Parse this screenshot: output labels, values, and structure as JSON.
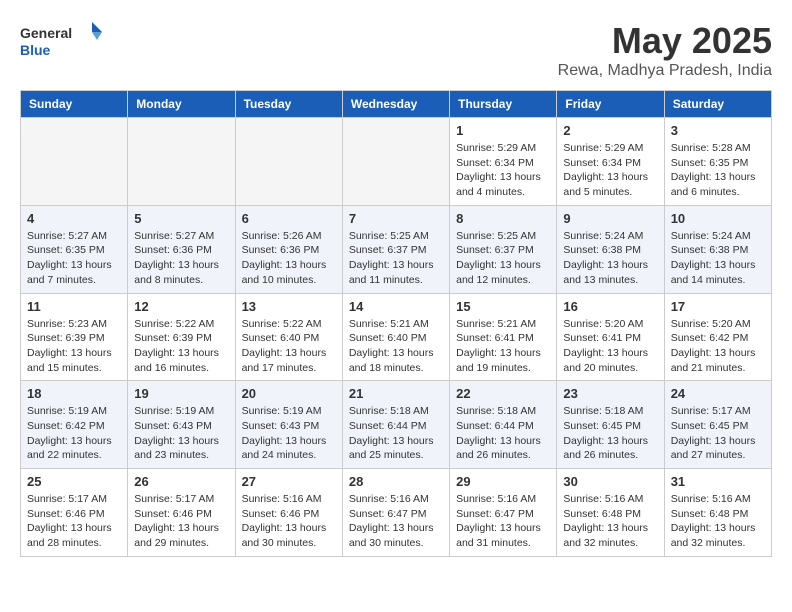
{
  "logo": {
    "general": "General",
    "blue": "Blue"
  },
  "title": "May 2025",
  "location": "Rewa, Madhya Pradesh, India",
  "days_of_week": [
    "Sunday",
    "Monday",
    "Tuesday",
    "Wednesday",
    "Thursday",
    "Friday",
    "Saturday"
  ],
  "weeks": [
    {
      "days": [
        {
          "number": "",
          "info": ""
        },
        {
          "number": "",
          "info": ""
        },
        {
          "number": "",
          "info": ""
        },
        {
          "number": "",
          "info": ""
        },
        {
          "number": "1",
          "info": "Sunrise: 5:29 AM\nSunset: 6:34 PM\nDaylight: 13 hours\nand 4 minutes."
        },
        {
          "number": "2",
          "info": "Sunrise: 5:29 AM\nSunset: 6:34 PM\nDaylight: 13 hours\nand 5 minutes."
        },
        {
          "number": "3",
          "info": "Sunrise: 5:28 AM\nSunset: 6:35 PM\nDaylight: 13 hours\nand 6 minutes."
        }
      ]
    },
    {
      "days": [
        {
          "number": "4",
          "info": "Sunrise: 5:27 AM\nSunset: 6:35 PM\nDaylight: 13 hours\nand 7 minutes."
        },
        {
          "number": "5",
          "info": "Sunrise: 5:27 AM\nSunset: 6:36 PM\nDaylight: 13 hours\nand 8 minutes."
        },
        {
          "number": "6",
          "info": "Sunrise: 5:26 AM\nSunset: 6:36 PM\nDaylight: 13 hours\nand 10 minutes."
        },
        {
          "number": "7",
          "info": "Sunrise: 5:25 AM\nSunset: 6:37 PM\nDaylight: 13 hours\nand 11 minutes."
        },
        {
          "number": "8",
          "info": "Sunrise: 5:25 AM\nSunset: 6:37 PM\nDaylight: 13 hours\nand 12 minutes."
        },
        {
          "number": "9",
          "info": "Sunrise: 5:24 AM\nSunset: 6:38 PM\nDaylight: 13 hours\nand 13 minutes."
        },
        {
          "number": "10",
          "info": "Sunrise: 5:24 AM\nSunset: 6:38 PM\nDaylight: 13 hours\nand 14 minutes."
        }
      ]
    },
    {
      "days": [
        {
          "number": "11",
          "info": "Sunrise: 5:23 AM\nSunset: 6:39 PM\nDaylight: 13 hours\nand 15 minutes."
        },
        {
          "number": "12",
          "info": "Sunrise: 5:22 AM\nSunset: 6:39 PM\nDaylight: 13 hours\nand 16 minutes."
        },
        {
          "number": "13",
          "info": "Sunrise: 5:22 AM\nSunset: 6:40 PM\nDaylight: 13 hours\nand 17 minutes."
        },
        {
          "number": "14",
          "info": "Sunrise: 5:21 AM\nSunset: 6:40 PM\nDaylight: 13 hours\nand 18 minutes."
        },
        {
          "number": "15",
          "info": "Sunrise: 5:21 AM\nSunset: 6:41 PM\nDaylight: 13 hours\nand 19 minutes."
        },
        {
          "number": "16",
          "info": "Sunrise: 5:20 AM\nSunset: 6:41 PM\nDaylight: 13 hours\nand 20 minutes."
        },
        {
          "number": "17",
          "info": "Sunrise: 5:20 AM\nSunset: 6:42 PM\nDaylight: 13 hours\nand 21 minutes."
        }
      ]
    },
    {
      "days": [
        {
          "number": "18",
          "info": "Sunrise: 5:19 AM\nSunset: 6:42 PM\nDaylight: 13 hours\nand 22 minutes."
        },
        {
          "number": "19",
          "info": "Sunrise: 5:19 AM\nSunset: 6:43 PM\nDaylight: 13 hours\nand 23 minutes."
        },
        {
          "number": "20",
          "info": "Sunrise: 5:19 AM\nSunset: 6:43 PM\nDaylight: 13 hours\nand 24 minutes."
        },
        {
          "number": "21",
          "info": "Sunrise: 5:18 AM\nSunset: 6:44 PM\nDaylight: 13 hours\nand 25 minutes."
        },
        {
          "number": "22",
          "info": "Sunrise: 5:18 AM\nSunset: 6:44 PM\nDaylight: 13 hours\nand 26 minutes."
        },
        {
          "number": "23",
          "info": "Sunrise: 5:18 AM\nSunset: 6:45 PM\nDaylight: 13 hours\nand 26 minutes."
        },
        {
          "number": "24",
          "info": "Sunrise: 5:17 AM\nSunset: 6:45 PM\nDaylight: 13 hours\nand 27 minutes."
        }
      ]
    },
    {
      "days": [
        {
          "number": "25",
          "info": "Sunrise: 5:17 AM\nSunset: 6:46 PM\nDaylight: 13 hours\nand 28 minutes."
        },
        {
          "number": "26",
          "info": "Sunrise: 5:17 AM\nSunset: 6:46 PM\nDaylight: 13 hours\nand 29 minutes."
        },
        {
          "number": "27",
          "info": "Sunrise: 5:16 AM\nSunset: 6:46 PM\nDaylight: 13 hours\nand 30 minutes."
        },
        {
          "number": "28",
          "info": "Sunrise: 5:16 AM\nSunset: 6:47 PM\nDaylight: 13 hours\nand 30 minutes."
        },
        {
          "number": "29",
          "info": "Sunrise: 5:16 AM\nSunset: 6:47 PM\nDaylight: 13 hours\nand 31 minutes."
        },
        {
          "number": "30",
          "info": "Sunrise: 5:16 AM\nSunset: 6:48 PM\nDaylight: 13 hours\nand 32 minutes."
        },
        {
          "number": "31",
          "info": "Sunrise: 5:16 AM\nSunset: 6:48 PM\nDaylight: 13 hours\nand 32 minutes."
        }
      ]
    }
  ]
}
